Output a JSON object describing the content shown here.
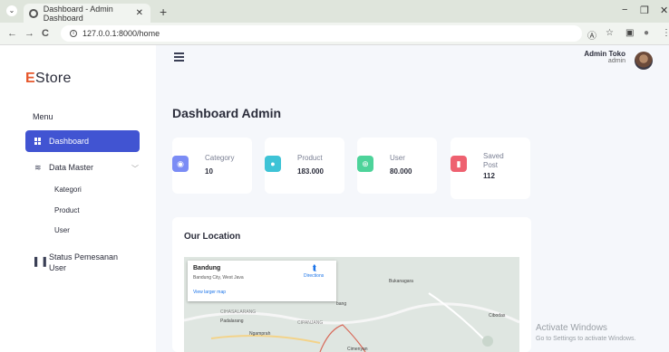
{
  "browser": {
    "tab_title": "Dashboard - Admin Dashboard",
    "tab_close": "✕",
    "new_tab": "+",
    "url": "127.0.0.1:8000/home",
    "minimize": "−",
    "maximize": "❐",
    "close": "✕",
    "dropdown": "⌄",
    "back": "←",
    "forward": "→",
    "reload": "C",
    "info": "i",
    "translate_icon": "Ⓐ",
    "star_icon": "☆",
    "sidepanel_icon": "▣",
    "profile_icon": "●",
    "menu_icon": "⋮"
  },
  "sidebar": {
    "brand_first": "E",
    "brand_rest": "Store",
    "menu_title": "Menu",
    "active_item": "Dashboard",
    "items": {
      "data_master": "Data Master",
      "kategori": "Kategori",
      "product": "Product",
      "user": "User",
      "status_line1": "Status Pemesanan",
      "status_line2": "User"
    },
    "chevron": "﹀"
  },
  "topbar": {
    "user_name": "Admin Toko",
    "user_role": "admin"
  },
  "main": {
    "title": "Dashboard Admin",
    "cards": [
      {
        "label": "Category",
        "value": "10",
        "color": "#7b8cf5",
        "icon": "eye-icon",
        "glyph": "◉"
      },
      {
        "label": "Product",
        "value": "183.000",
        "color": "#3ec3d6",
        "icon": "person-icon",
        "glyph": "●"
      },
      {
        "label": "User",
        "value": "80.000",
        "color": "#4dd39a",
        "icon": "add-user-icon",
        "glyph": "⊕"
      },
      {
        "label": "Saved",
        "label2": "Post",
        "value": "112",
        "color": "#ee6170",
        "icon": "bookmark-icon",
        "glyph": "▮"
      }
    ],
    "location_title": "Our Location",
    "map": {
      "place": "Bandung",
      "subtitle": "Bandung City, West Java",
      "larger_map": "View larger map",
      "directions": "Directions",
      "labels": {
        "bukanagara": "Bukanagara",
        "cibodas": "Cibodas",
        "padalarang": "Padalarang",
        "ngamprah": "Ngamprah",
        "cipanjang": "CIPANJANG",
        "cimenyan": "Cimenyan",
        "cihasalarang": "CIHASALARANG",
        "bang": "bang"
      }
    }
  },
  "watermark": {
    "line1": "Activate Windows",
    "line2": "Go to Settings to activate Windows."
  }
}
